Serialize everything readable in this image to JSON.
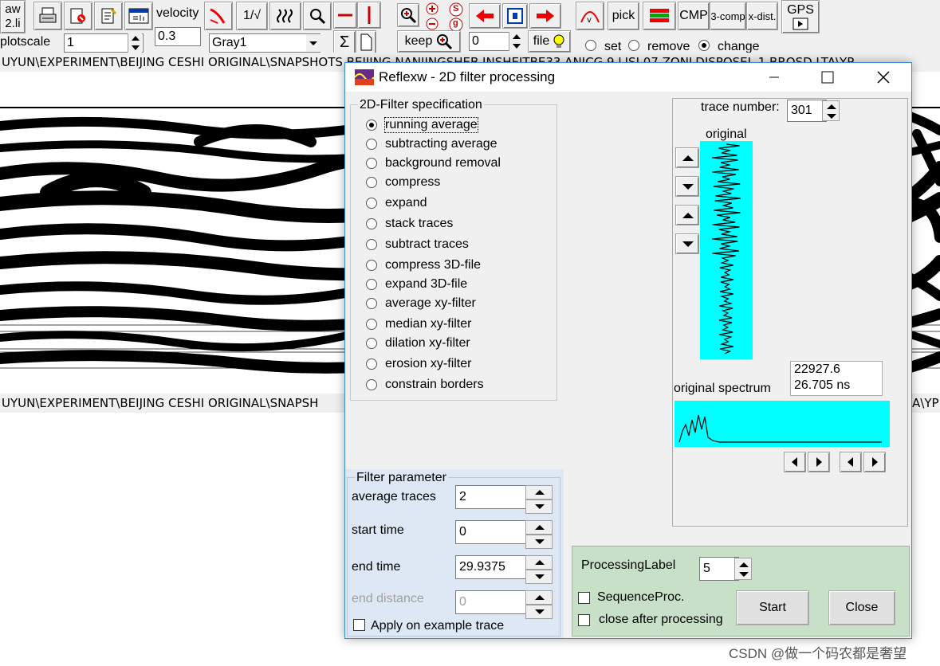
{
  "toolbar": {
    "btn_aw_line1": "aw",
    "btn_aw_line2": "2.li",
    "velocity_label": "velocity",
    "velocity_value": "0.3",
    "plotscale_label": "plotscale",
    "plotscale_value": "1",
    "colormap_value": "Gray1",
    "scale_label": "1/√",
    "sigma_label": "Σ",
    "keep_label": "keep",
    "file_label": "file",
    "counter_value": "0",
    "pick_label": "pick",
    "cmp_label": "CMP",
    "comp3_label": "3-comp",
    "xdist_label": "x-dist.",
    "gps_label": "GPS",
    "radio_set": "set",
    "radio_remove": "remove",
    "radio_change": "change",
    "selected_radio": "change",
    "zoom_s": "S",
    "zoom_g": "g"
  },
  "path_top": "UYUN\\EXPERIMENT\\BEIJING CESHI ORIGINAL\\SNAPSHOTS BEIJING NANJINGSHEB INSHEJTBE33 ANJCG 9 LISI.07 ZONLDISPOSEL 1 BROSD.LTA\\YP",
  "path_bottom_left": "UYUN\\EXPERIMENT\\BEIJING CESHI ORIGINAL\\SNAPSH",
  "path_bottom_right": "A\\YP",
  "dialog": {
    "title": "Reflexw - 2D filter processing",
    "spec_group_title": "2D-Filter specification",
    "options": [
      "running average",
      "subtracting average",
      "background removal",
      "compress",
      "expand",
      "stack traces",
      "subtract traces",
      "compress 3D-file",
      "expand 3D-file",
      "average xy-filter",
      "median xy-filter",
      "dilation xy-filter",
      "erosion xy-filter",
      "constrain borders"
    ],
    "selected_option": "running average",
    "param_group_title": "Filter parameter",
    "params": {
      "average_traces_label": "average traces",
      "average_traces_value": "2",
      "start_time_label": "start time",
      "start_time_value": "0",
      "end_time_label": "end time",
      "end_time_value": "29.9375",
      "end_distance_label": "end distance",
      "end_distance_value": "0"
    },
    "apply_example_label": "Apply on example trace",
    "trace_number_label": "trace number:",
    "trace_number_value": "301",
    "original_label": "original",
    "spectrum_label": "original spectrum",
    "readout_value1": "22927.6",
    "readout_value2": "26.705 ns",
    "processing_label": "ProcessingLabel",
    "processing_value": "5",
    "sequence_proc_label": "SequenceProc.",
    "close_after_label": "close after processing",
    "start_button": "Start",
    "close_button": "Close"
  },
  "watermark": "CSDN @做一个码农都是奢望",
  "colors": {
    "trace_bg": "#00ffff",
    "green_panel": "#c8e0c8",
    "param_panel": "#dde8f4",
    "accent": "#3c8ec9"
  }
}
